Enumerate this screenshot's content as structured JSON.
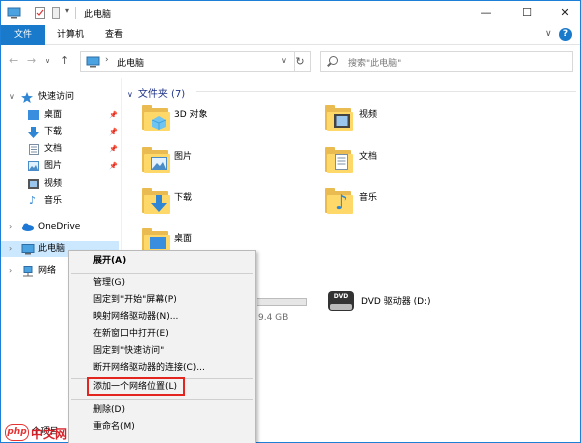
{
  "window": {
    "title": "此电脑",
    "controls": {
      "minimize": "—",
      "maximize": "☐",
      "close": "✕"
    }
  },
  "ribbon": {
    "tabs": [
      {
        "label": "文件"
      },
      {
        "label": "计算机"
      },
      {
        "label": "查看"
      }
    ],
    "expand_glyph": "∨",
    "help_glyph": "?"
  },
  "address": {
    "path": "此电脑",
    "search_placeholder": "搜索\"此电脑\""
  },
  "sidebar": {
    "items": [
      {
        "label": "快速访问",
        "icon": "star-icon"
      },
      {
        "label": "桌面",
        "icon": "desktop-icon",
        "pinned": true
      },
      {
        "label": "下载",
        "icon": "download-icon",
        "pinned": true
      },
      {
        "label": "文档",
        "icon": "document-icon",
        "pinned": true
      },
      {
        "label": "图片",
        "icon": "picture-icon",
        "pinned": true
      },
      {
        "label": "视频",
        "icon": "video-icon"
      },
      {
        "label": "音乐",
        "icon": "music-icon"
      },
      {
        "label": "OneDrive",
        "icon": "cloud-icon"
      },
      {
        "label": "此电脑",
        "icon": "computer-icon",
        "selected": true
      },
      {
        "label": "网络",
        "icon": "network-icon"
      }
    ]
  },
  "main": {
    "section_title": "文件夹 (7)",
    "folders": [
      {
        "label": "3D 对象",
        "icon": "3d-objects-icon"
      },
      {
        "label": "视频",
        "icon": "video-icon"
      },
      {
        "label": "图片",
        "icon": "picture-icon"
      },
      {
        "label": "文档",
        "icon": "document-icon"
      },
      {
        "label": "下载",
        "icon": "download-icon"
      },
      {
        "label": "音乐",
        "icon": "music-icon"
      },
      {
        "label": "桌面",
        "icon": "desktop-icon"
      }
    ],
    "drive_partial_size": "9.4 GB",
    "dvd_drive": {
      "label": "DVD 驱动器 (D:)",
      "badge": "DVD"
    }
  },
  "context_menu": {
    "items": [
      {
        "label": "展开(A)",
        "bold": true
      },
      {
        "label": "管理(G)"
      },
      {
        "label": "固定到\"开始\"屏幕(P)"
      },
      {
        "label": "映射网络驱动器(N)..."
      },
      {
        "label": "在新窗口中打开(E)"
      },
      {
        "label": "固定到\"快速访问\""
      },
      {
        "label": "断开网络驱动器的连接(C)..."
      },
      {
        "label": "添加一个网络位置(L)",
        "highlighted": true
      },
      {
        "label": "删除(D)"
      },
      {
        "label": "重命名(M)"
      }
    ]
  },
  "status": {
    "count": "8 个项目"
  },
  "watermark": {
    "badge": "php",
    "text": "中文网"
  },
  "colors": {
    "accent": "#1979ca",
    "highlight_box": "#e2251f",
    "selection": "#cce8ff"
  }
}
